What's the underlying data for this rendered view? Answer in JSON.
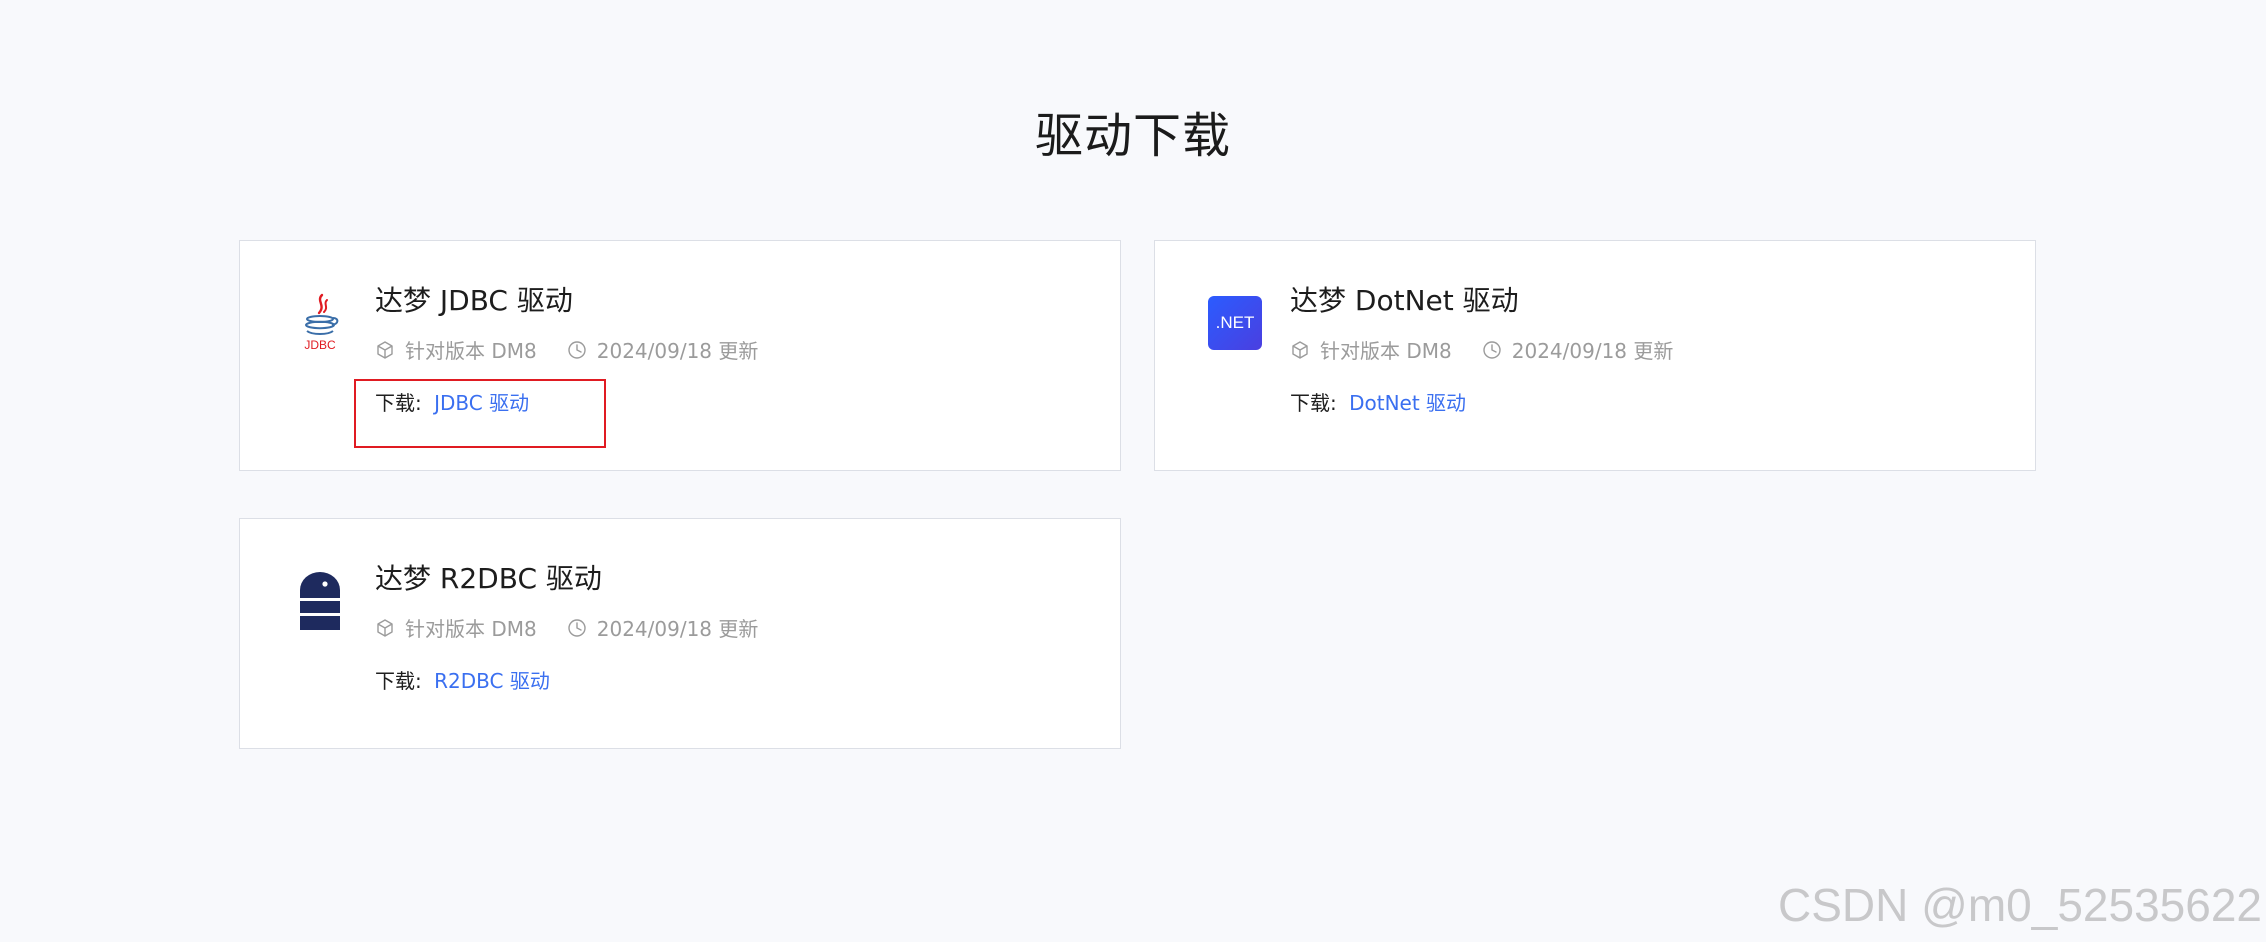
{
  "page": {
    "title": "驱动下载"
  },
  "cards": [
    {
      "title": "达梦 JDBC 驱动",
      "logo_icon": "java-jdbc-logo-icon",
      "logo_text": "JDBC",
      "version": "针对版本 DM8",
      "updated": "2024/09/18 更新",
      "download_label": "下载:",
      "download_link": "JDBC 驱动",
      "highlighted": true
    },
    {
      "title": "达梦 DotNet 驱动",
      "logo_icon": "dotnet-logo-icon",
      "logo_text": ".NET",
      "version": "针对版本 DM8",
      "updated": "2024/09/18 更新",
      "download_label": "下载:",
      "download_link": "DotNet 驱动",
      "highlighted": false
    },
    {
      "title": "达梦 R2DBC 驱动",
      "logo_icon": "database-logo-icon",
      "version": "针对版本 DM8",
      "updated": "2024/09/18 更新",
      "download_label": "下载:",
      "download_link": "R2DBC 驱动",
      "highlighted": false
    }
  ],
  "colors": {
    "background": "#f8f9fc",
    "link": "#3a6ff0",
    "highlight": "#e01b22",
    "dotnet_logo": "#2b5cff",
    "r2dbc_logo": "#1e2a5e",
    "jdbc_red": "#e01b22"
  },
  "watermark": "CSDN @m0_52535622"
}
